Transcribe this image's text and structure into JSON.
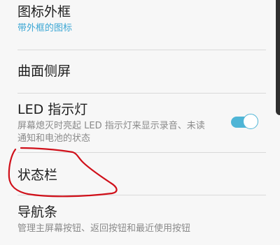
{
  "settings": {
    "items": [
      {
        "title": "图标外框",
        "subtitle": "带外框的图标"
      },
      {
        "title": "曲面侧屏"
      },
      {
        "title": "LED 指示灯",
        "subtitle_line1": "屏幕熄灭时亮起 LED 指示灯来显示录音、未读",
        "subtitle_line2": "通知和电池的状态",
        "toggle_on": true
      },
      {
        "title": "状态栏"
      },
      {
        "title": "导航条",
        "subtitle": "管理主屏幕按钮、返回按钮和最近使用按钮"
      }
    ]
  },
  "colors": {
    "accent": "#3aa6d4",
    "toggle": "#4fb5d6",
    "annotation": "#d0101a"
  }
}
